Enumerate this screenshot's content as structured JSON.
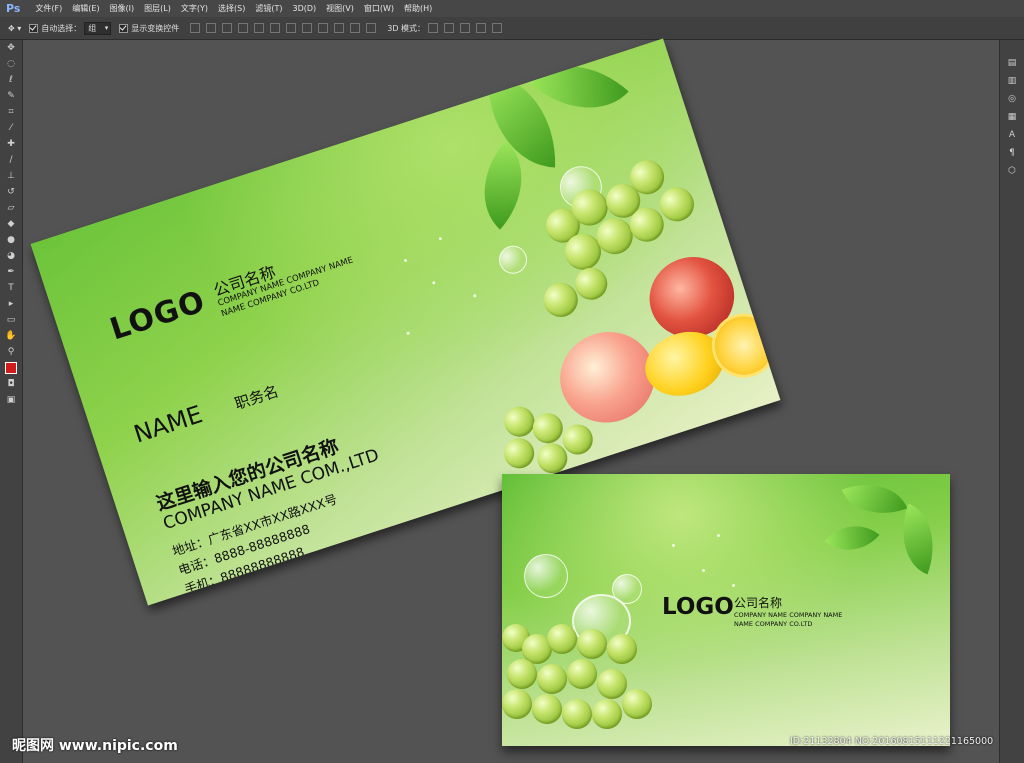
{
  "app": {
    "logo": "Ps"
  },
  "menu": [
    "文件(F)",
    "编辑(E)",
    "图像(I)",
    "图层(L)",
    "文字(Y)",
    "选择(S)",
    "滤镜(T)",
    "3D(D)",
    "视图(V)",
    "窗口(W)",
    "帮助(H)"
  ],
  "options": {
    "auto_select_label": "自动选择：",
    "auto_select_value": "组",
    "show_transform_label": "显示变换控件",
    "mode_3d_label": "3D 模式："
  },
  "front_card": {
    "logo": "LOGO",
    "company_cn": "公司名称",
    "company_en_1": "COMPANY NAME COMPANY NAME",
    "company_en_2": "NAME COMPANY CO.LTD",
    "name": "NAME",
    "position": "职务名",
    "input_company": "这里输入您的公司名称",
    "company_en_big": "COMPANY NAME COM.,LTD",
    "address": "地址：广东省XX市XX路XXX号",
    "phone": "电话：8888-88888888",
    "mobile": "手机：88888888888"
  },
  "back_card": {
    "logo": "LOGO",
    "company_cn": "公司名称",
    "company_en_1": "COMPANY NAME COMPANY NAME",
    "company_en_2": "NAME COMPANY CO.LTD"
  },
  "watermark": "昵图网 www.nipic.com",
  "id_tag": "ID:21132804 NO:20160815111221165000",
  "colors": {
    "card_green": "#6cc43a",
    "ps_dark": "#535353"
  }
}
